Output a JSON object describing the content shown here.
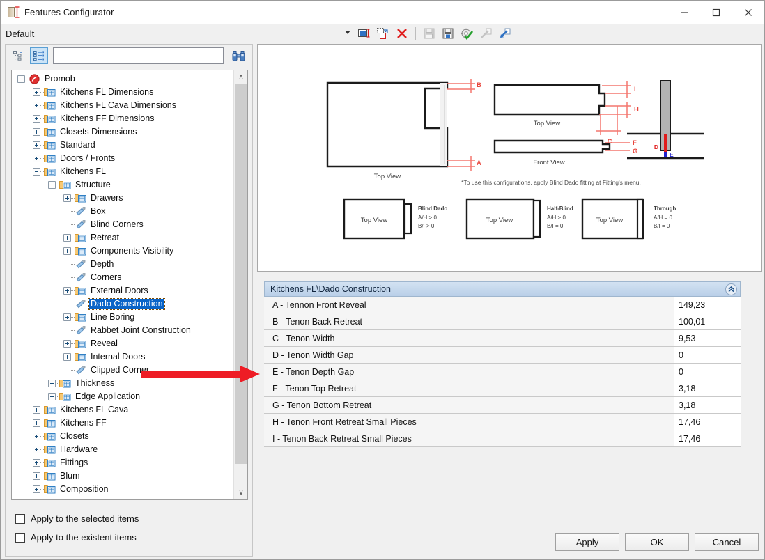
{
  "window": {
    "title": "Features Configurator",
    "icon": "door-measure-icon",
    "minimize_label": "─",
    "maximize_label": "□",
    "close_label": "✕"
  },
  "command_bar": {
    "profile": "Default",
    "dropdown_icon": "chevron-down-icon",
    "tools": [
      {
        "name": "rename-configuration-icon",
        "enabled": true
      },
      {
        "name": "duplicate-configuration-icon",
        "enabled": true
      },
      {
        "name": "delete-configuration-icon",
        "enabled": true
      },
      {
        "name": "save-icon",
        "enabled": false
      },
      {
        "name": "save-as-icon",
        "enabled": true
      },
      {
        "name": "settings-apply-icon",
        "enabled": true
      },
      {
        "name": "export-icon",
        "enabled": false
      },
      {
        "name": "import-icon",
        "enabled": true
      }
    ]
  },
  "left_panel": {
    "collapse_tree_icon": "collapse-tree-icon",
    "expand_tree_icon": "expand-tree-icon",
    "search": {
      "value": "",
      "placeholder": ""
    },
    "find_icon": "binoculars-icon",
    "scrollbar": {
      "up_icon": "∧",
      "down_icon": "∨"
    },
    "tree": [
      {
        "label": "Promob",
        "depth": 0,
        "icon": "promob-logo",
        "state": "expanded"
      },
      {
        "label": "Kitchens FL Dimensions",
        "depth": 1,
        "icon": "folder-table",
        "state": "collapsed"
      },
      {
        "label": "Kitchens FL Cava Dimensions",
        "depth": 1,
        "icon": "folder-table",
        "state": "collapsed"
      },
      {
        "label": "Kitchens FF Dimensions",
        "depth": 1,
        "icon": "folder-table",
        "state": "collapsed"
      },
      {
        "label": "Closets Dimensions",
        "depth": 1,
        "icon": "folder-table",
        "state": "collapsed"
      },
      {
        "label": "Standard",
        "depth": 1,
        "icon": "folder-table",
        "state": "collapsed"
      },
      {
        "label": "Doors / Fronts",
        "depth": 1,
        "icon": "folder-table",
        "state": "collapsed"
      },
      {
        "label": "Kitchens FL",
        "depth": 1,
        "icon": "folder-table",
        "state": "expanded"
      },
      {
        "label": "Structure",
        "depth": 2,
        "icon": "folder-table",
        "state": "expanded"
      },
      {
        "label": "Drawers",
        "depth": 3,
        "icon": "folder-table",
        "state": "collapsed"
      },
      {
        "label": "Box",
        "depth": 3,
        "icon": "tag",
        "state": "leaf"
      },
      {
        "label": "Blind Corners",
        "depth": 3,
        "icon": "tag",
        "state": "leaf"
      },
      {
        "label": "Retreat",
        "depth": 3,
        "icon": "folder-table",
        "state": "collapsed"
      },
      {
        "label": "Components Visibility",
        "depth": 3,
        "icon": "folder-table",
        "state": "collapsed"
      },
      {
        "label": "Depth",
        "depth": 3,
        "icon": "tag",
        "state": "leaf"
      },
      {
        "label": "Corners",
        "depth": 3,
        "icon": "tag",
        "state": "leaf"
      },
      {
        "label": "External Doors",
        "depth": 3,
        "icon": "folder-table",
        "state": "collapsed"
      },
      {
        "label": "Dado Construction",
        "depth": 3,
        "icon": "tag",
        "state": "leaf",
        "selected": true
      },
      {
        "label": "Line Boring",
        "depth": 3,
        "icon": "folder-table",
        "state": "collapsed"
      },
      {
        "label": "Rabbet Joint Construction",
        "depth": 3,
        "icon": "tag",
        "state": "leaf"
      },
      {
        "label": "Reveal",
        "depth": 3,
        "icon": "folder-table",
        "state": "collapsed"
      },
      {
        "label": "Internal Doors",
        "depth": 3,
        "icon": "folder-table",
        "state": "collapsed"
      },
      {
        "label": "Clipped Corner",
        "depth": 3,
        "icon": "tag",
        "state": "leaf"
      },
      {
        "label": "Thickness",
        "depth": 2,
        "icon": "folder-table",
        "state": "collapsed"
      },
      {
        "label": "Edge Application",
        "depth": 2,
        "icon": "folder-table",
        "state": "collapsed"
      },
      {
        "label": "Kitchens FL Cava",
        "depth": 1,
        "icon": "folder-table",
        "state": "collapsed"
      },
      {
        "label": "Kitchens FF",
        "depth": 1,
        "icon": "folder-table",
        "state": "collapsed"
      },
      {
        "label": "Closets",
        "depth": 1,
        "icon": "folder-table",
        "state": "collapsed"
      },
      {
        "label": "Hardware",
        "depth": 1,
        "icon": "folder-table",
        "state": "collapsed"
      },
      {
        "label": "Fittings",
        "depth": 1,
        "icon": "folder-table",
        "state": "collapsed"
      },
      {
        "label": "Blum",
        "depth": 1,
        "icon": "folder-table",
        "state": "collapsed"
      },
      {
        "label": "Composition",
        "depth": 1,
        "icon": "folder-table",
        "state": "collapsed"
      }
    ]
  },
  "checkboxes": [
    {
      "label": "Apply to the selected items",
      "checked": false
    },
    {
      "label": "Apply to the existent items",
      "checked": false
    }
  ],
  "diagram": {
    "labels": {
      "top_view": "Top View",
      "front_view": "Front View"
    },
    "dimension_marks": [
      "A",
      "B",
      "C",
      "D",
      "E",
      "F",
      "G",
      "H",
      "I"
    ],
    "note": "*To use this configurations, apply Blind Dado fitting at Fitting's menu.",
    "variants": [
      {
        "box_label": "Top View",
        "title": "Blind Dado",
        "line1": "A/H > 0",
        "line2": "B/I  > 0"
      },
      {
        "box_label": "Top View",
        "title": "Half-Blind",
        "line1": "A/H > 0",
        "line2": "B/I  = 0"
      },
      {
        "box_label": "Top View",
        "title": "Through",
        "line1": "A/H = 0",
        "line2": "B/I  = 0"
      }
    ]
  },
  "property_grid": {
    "header": "Kitchens FL\\Dado Construction",
    "collapse_icon": "chevron-up-double-icon",
    "rows": [
      {
        "name": "A - Tennon Front Reveal",
        "value": "149,23"
      },
      {
        "name": "B - Tenon Back Retreat",
        "value": "100,01"
      },
      {
        "name": "C - Tenon Width",
        "value": "9,53"
      },
      {
        "name": "D - Tenon Width Gap",
        "value": "0"
      },
      {
        "name": "E - Tenon Depth Gap",
        "value": "0"
      },
      {
        "name": "F - Tenon Top Retreat",
        "value": "3,18"
      },
      {
        "name": "G - Tenon Bottom Retreat",
        "value": "3,18"
      },
      {
        "name": "H - Tenon Front Retreat Small Pieces",
        "value": "17,46"
      },
      {
        "name": "I - Tenon Back Retreat Small Pieces",
        "value": "17,46"
      }
    ]
  },
  "annotation": {
    "arrow_color": "#ee1c25",
    "points_to_row_index": 4
  },
  "footer_buttons": [
    {
      "label": "Apply",
      "name": "apply-button"
    },
    {
      "label": "OK",
      "name": "ok-button"
    },
    {
      "label": "Cancel",
      "name": "cancel-button"
    }
  ]
}
